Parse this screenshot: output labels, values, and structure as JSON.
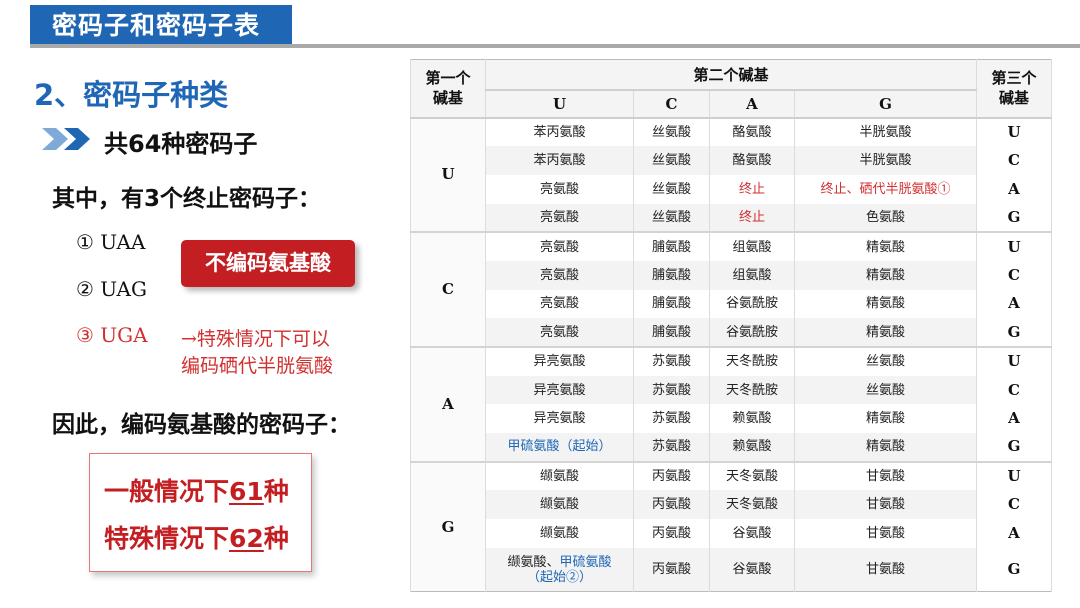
{
  "header": {
    "title": "密码子和密码子表"
  },
  "left": {
    "section_heading": "2、密码子种类",
    "total": "共64种密码子",
    "stop_intro": "其中，有3个终止密码子：",
    "stop_codons": [
      {
        "label": "① UAA",
        "highlight": false
      },
      {
        "label": "② UAG",
        "highlight": false
      },
      {
        "label": "③ UGA",
        "highlight": true
      }
    ],
    "no_code_badge": "不编码氨基酸",
    "note_line1": "→特殊情况下可以",
    "note_line2": "编码硒代半胱氨酸",
    "therefore": "因此，编码氨基酸的密码子：",
    "count_normal_prefix": "一般情况下",
    "count_normal_num": "61",
    "count_normal_suffix": "种",
    "count_special_prefix": "特殊情况下",
    "count_special_num": "62",
    "count_special_suffix": "种"
  },
  "table": {
    "header_first": "第一个碱基",
    "header_second": "第二个碱基",
    "header_third": "第三个碱基",
    "second_bases": [
      "U",
      "C",
      "A",
      "G"
    ],
    "groups": [
      {
        "first": "U",
        "rows": [
          {
            "cells": [
              "苯丙氨酸",
              "丝氨酸",
              "酪氨酸",
              "半胱氨酸"
            ],
            "third": "U"
          },
          {
            "cells": [
              "苯丙氨酸",
              "丝氨酸",
              "酪氨酸",
              "半胱氨酸"
            ],
            "third": "C"
          },
          {
            "cells": [
              "亮氨酸",
              "丝氨酸",
              "终止",
              "终止、硒代半胱氨酸①"
            ],
            "third": "A"
          },
          {
            "cells": [
              "亮氨酸",
              "丝氨酸",
              "终止",
              "色氨酸"
            ],
            "third": "G"
          }
        ]
      },
      {
        "first": "C",
        "rows": [
          {
            "cells": [
              "亮氨酸",
              "脯氨酸",
              "组氨酸",
              "精氨酸"
            ],
            "third": "U"
          },
          {
            "cells": [
              "亮氨酸",
              "脯氨酸",
              "组氨酸",
              "精氨酸"
            ],
            "third": "C"
          },
          {
            "cells": [
              "亮氨酸",
              "脯氨酸",
              "谷氨酰胺",
              "精氨酸"
            ],
            "third": "A"
          },
          {
            "cells": [
              "亮氨酸",
              "脯氨酸",
              "谷氨酰胺",
              "精氨酸"
            ],
            "third": "G"
          }
        ]
      },
      {
        "first": "A",
        "rows": [
          {
            "cells": [
              "异亮氨酸",
              "苏氨酸",
              "天冬酰胺",
              "丝氨酸"
            ],
            "third": "U"
          },
          {
            "cells": [
              "异亮氨酸",
              "苏氨酸",
              "天冬酰胺",
              "丝氨酸"
            ],
            "third": "C"
          },
          {
            "cells": [
              "异亮氨酸",
              "苏氨酸",
              "赖氨酸",
              "精氨酸"
            ],
            "third": "A"
          },
          {
            "cells": [
              "甲硫氨酸（起始）",
              "苏氨酸",
              "赖氨酸",
              "精氨酸"
            ],
            "third": "G"
          }
        ]
      },
      {
        "first": "G",
        "rows": [
          {
            "cells": [
              "缬氨酸",
              "丙氨酸",
              "天冬氨酸",
              "甘氨酸"
            ],
            "third": "U"
          },
          {
            "cells": [
              "缬氨酸",
              "丙氨酸",
              "天冬氨酸",
              "甘氨酸"
            ],
            "third": "C"
          },
          {
            "cells": [
              "缬氨酸",
              "丙氨酸",
              "谷氨酸",
              "甘氨酸"
            ],
            "third": "A"
          },
          {
            "cells": [
              "缬氨酸、甲硫氨酸（起始②）",
              "丙氨酸",
              "谷氨酸",
              "甘氨酸"
            ],
            "third": "G"
          }
        ]
      }
    ],
    "special_cells": {
      "U-2-2": "red",
      "U-2-3": "red",
      "U-3-2": "red",
      "A-3-0": "blue"
    },
    "last_cell_part1": "缬氨酸、",
    "last_cell_part2": "甲硫氨酸",
    "last_cell_part3": "（起始②）"
  },
  "colors": {
    "brand_blue": "#1f66b5",
    "accent_red": "#c31e22",
    "note_red": "#d13030"
  }
}
